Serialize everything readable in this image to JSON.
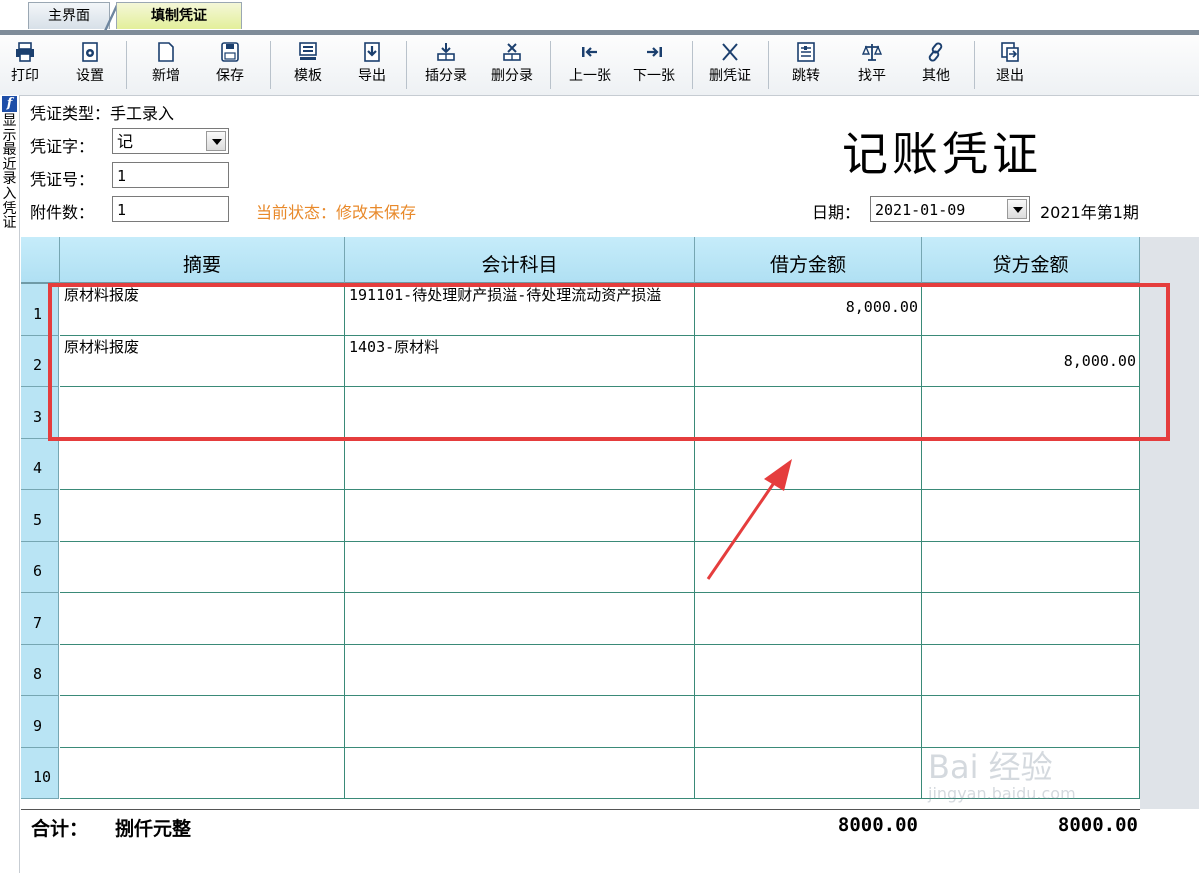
{
  "tabs": [
    {
      "label": "主界面"
    },
    {
      "label": "填制凭证"
    }
  ],
  "toolbar": [
    {
      "label": "打印",
      "icon": "printer-icon"
    },
    {
      "label": "设置",
      "icon": "settings-icon"
    },
    {
      "label": "新增",
      "icon": "new-doc-icon"
    },
    {
      "label": "保存",
      "icon": "save-icon"
    },
    {
      "label": "模板",
      "icon": "template-icon"
    },
    {
      "label": "导出",
      "icon": "export-icon"
    },
    {
      "label": "插分录",
      "icon": "insert-entry-icon"
    },
    {
      "label": "删分录",
      "icon": "delete-entry-icon"
    },
    {
      "label": "上一张",
      "icon": "prev-icon"
    },
    {
      "label": "下一张",
      "icon": "next-icon"
    },
    {
      "label": "删凭证",
      "icon": "delete-voucher-icon"
    },
    {
      "label": "跳转",
      "icon": "jump-icon"
    },
    {
      "label": "找平",
      "icon": "balance-icon"
    },
    {
      "label": "其他",
      "icon": "other-icon"
    },
    {
      "label": "退出",
      "icon": "exit-icon"
    }
  ],
  "sidebar": {
    "icon_letter": "f",
    "text": "显示最近录入凭证"
  },
  "header": {
    "type_label": "凭证类型：",
    "type_value": "手工录入",
    "word_label": "凭证字：",
    "word_value": "记",
    "number_label": "凭证号：",
    "number_value": "1",
    "attach_label": "附件数：",
    "attach_value": "1",
    "status_text": "当前状态：修改未保存",
    "title": "记账凭证",
    "date_label": "日期：",
    "date_value": "2021-01-09",
    "period": "2021年第1期"
  },
  "table": {
    "columns": [
      "摘要",
      "会计科目",
      "借方金额",
      "贷方金额"
    ],
    "rows": [
      {
        "no": "1",
        "summary": "原材料报废",
        "account": "191101-待处理财产损溢-待处理流动资产损溢",
        "debit": "8,000.00",
        "credit": ""
      },
      {
        "no": "2",
        "summary": "原材料报废",
        "account": "1403-原材料",
        "debit": "",
        "credit": "8,000.00"
      },
      {
        "no": "3",
        "summary": "",
        "account": "",
        "debit": "",
        "credit": ""
      },
      {
        "no": "4",
        "summary": "",
        "account": "",
        "debit": "",
        "credit": ""
      },
      {
        "no": "5",
        "summary": "",
        "account": "",
        "debit": "",
        "credit": ""
      },
      {
        "no": "6",
        "summary": "",
        "account": "",
        "debit": "",
        "credit": ""
      },
      {
        "no": "7",
        "summary": "",
        "account": "",
        "debit": "",
        "credit": ""
      },
      {
        "no": "8",
        "summary": "",
        "account": "",
        "debit": "",
        "credit": ""
      },
      {
        "no": "9",
        "summary": "",
        "account": "",
        "debit": "",
        "credit": ""
      },
      {
        "no": "10",
        "summary": "",
        "account": "",
        "debit": "",
        "credit": ""
      }
    ]
  },
  "totals": {
    "label": "合计：",
    "words": "捌仟元整",
    "debit": "8000.00",
    "credit": "8000.00"
  },
  "watermark": {
    "main": "Bai 经验",
    "sub": "jingyan.baidu.com"
  },
  "colors": {
    "header_bg": "#b8e6f6",
    "status": "#e8892a",
    "highlight": "#e53d3d",
    "grid_line": "#3a8a78"
  }
}
